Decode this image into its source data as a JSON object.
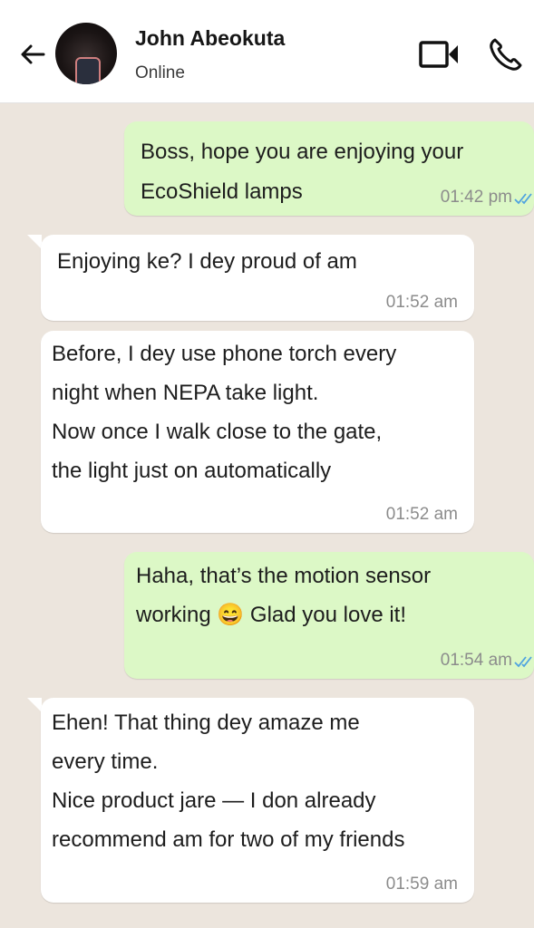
{
  "header": {
    "contact_name": "John Abeokuta",
    "status": "Online"
  },
  "icons": {
    "back": "arrow-left-icon",
    "video": "video-camera-icon",
    "call": "phone-icon",
    "read": "double-check-icon"
  },
  "colors": {
    "outgoing_bubble": "#dcf8c6",
    "incoming_bubble": "#ffffff",
    "chat_background": "#ece5dd",
    "read_tick": "#4fa3e0"
  },
  "messages": [
    {
      "direction": "outgoing",
      "text": "Boss, hope you are enjoying your\nEcoShield lamps",
      "time": "01:42 pm"
    },
    {
      "direction": "incoming",
      "text": "Enjoying ke? I dey proud of am",
      "time": "01:52 am"
    },
    {
      "direction": "incoming",
      "text": "Before, I dey use phone torch every\nnight when NEPA take light.\nNow once I walk close to the gate,\nthe light just on automatically",
      "time": "01:52 am"
    },
    {
      "direction": "outgoing",
      "text": "Haha, that’s the motion sensor\nworking 😄 Glad you love it!",
      "time": "01:54 am"
    },
    {
      "direction": "incoming",
      "text": "Ehen! That thing dey amaze me\nevery time.\nNice product jare — I don already\nrecommend am for two of my friends",
      "time": "01:59 am"
    }
  ]
}
